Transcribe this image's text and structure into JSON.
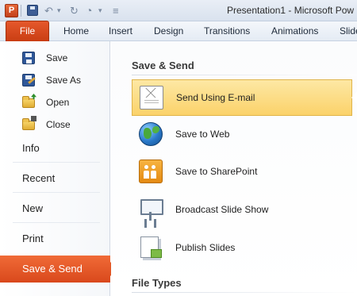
{
  "titlebar": {
    "app_icon_letter": "P",
    "window_title": "Presentation1 - Microsoft Pow",
    "qat": {
      "undo": "↶",
      "redo": "↻",
      "dropdown": "▾",
      "customize": "≡"
    }
  },
  "ribbon": {
    "file_tab": "File",
    "tabs": [
      "Home",
      "Insert",
      "Design",
      "Transitions",
      "Animations",
      "Slide"
    ]
  },
  "backstage_nav": {
    "commands": [
      {
        "label": "Save",
        "icon": "save-icon"
      },
      {
        "label": "Save As",
        "icon": "save-as-icon"
      },
      {
        "label": "Open",
        "icon": "open-folder-icon"
      },
      {
        "label": "Close",
        "icon": "close-folder-icon"
      }
    ],
    "tabs": [
      {
        "label": "Info"
      },
      {
        "label": "Recent"
      },
      {
        "label": "New"
      },
      {
        "label": "Print"
      },
      {
        "label": "Save & Send",
        "selected": true
      }
    ]
  },
  "content": {
    "section1_title": "Save & Send",
    "options": [
      {
        "label": "Send Using E-mail",
        "icon": "email-icon",
        "selected": true
      },
      {
        "label": "Save to Web",
        "icon": "globe-icon"
      },
      {
        "label": "Save to SharePoint",
        "icon": "sharepoint-icon"
      },
      {
        "label": "Broadcast Slide Show",
        "icon": "broadcast-icon"
      },
      {
        "label": "Publish Slides",
        "icon": "publish-slides-icon"
      }
    ],
    "section2_title": "File Types"
  },
  "colors": {
    "accent_orange": "#d9481c",
    "selected_option_bg": "#fbd26a",
    "ribbon_bg": "#e4ebf4"
  }
}
